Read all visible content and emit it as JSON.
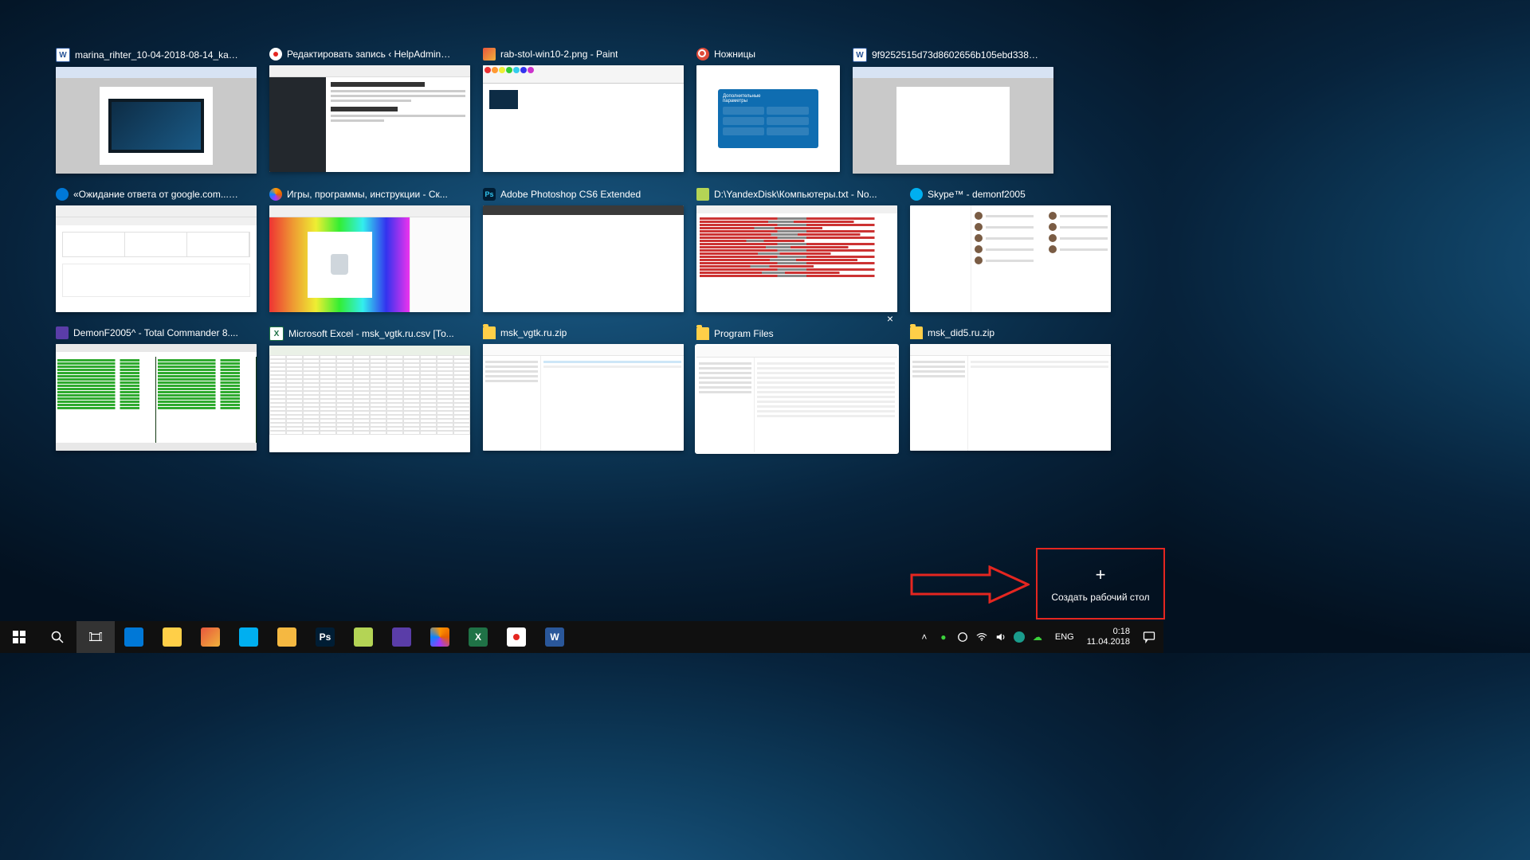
{
  "rows": [
    [
      {
        "key": "word1",
        "icon": "word",
        "title": "marina_rihter_10-04-2018-08-14_kak_..."
      },
      {
        "key": "yandex",
        "icon": "yandex",
        "title": "Редактировать запись ‹ HelpAdmins...."
      },
      {
        "key": "paint",
        "icon": "paint",
        "title": "rab-stol-win10-2.png - Paint"
      },
      {
        "key": "snip",
        "icon": "snip",
        "title": "Ножницы"
      },
      {
        "key": "word2",
        "icon": "word",
        "title": "9f9252515d73d8602656b105ebd338c..."
      }
    ],
    [
      {
        "key": "edge",
        "icon": "edge",
        "title": "«Ожидание ответа от google.com...»..."
      },
      {
        "key": "firefox",
        "icon": "firefox",
        "title": "Игры, программы, инструкции - Ск..."
      },
      {
        "key": "ps",
        "icon": "ps",
        "title": "Adobe Photoshop CS6 Extended"
      },
      {
        "key": "npp",
        "icon": "npp",
        "title": "D:\\YandexDisk\\Компьютеры.txt - No..."
      },
      {
        "key": "skype",
        "icon": "skype",
        "title": "Skype™ - demonf2005"
      }
    ],
    [
      {
        "key": "tc",
        "icon": "tc",
        "title": "DemonF2005^ - Total Commander 8...."
      },
      {
        "key": "excel",
        "icon": "excel",
        "title": "Microsoft Excel - msk_vgtk.ru.csv  [То..."
      },
      {
        "key": "folder1",
        "icon": "folder",
        "title": "msk_vgtk.ru.zip"
      },
      {
        "key": "folder2",
        "icon": "folder",
        "title": "Program Files",
        "selected": true,
        "close": "×"
      },
      {
        "key": "folder3",
        "icon": "folder",
        "title": "msk_did5.ru.zip"
      }
    ]
  ],
  "snip_card_title": "Дополнительные параметры",
  "new_desktop_label": "Создать рабочий стол",
  "taskbar": {
    "apps": [
      "start",
      "search",
      "taskview",
      "edge",
      "explorer",
      "paint",
      "skype",
      "painttool",
      "ps",
      "npp",
      "tc",
      "firefox",
      "excel",
      "yandex",
      "word"
    ],
    "lang": "ENG",
    "time": "0:18",
    "date": "11.04.2018"
  }
}
